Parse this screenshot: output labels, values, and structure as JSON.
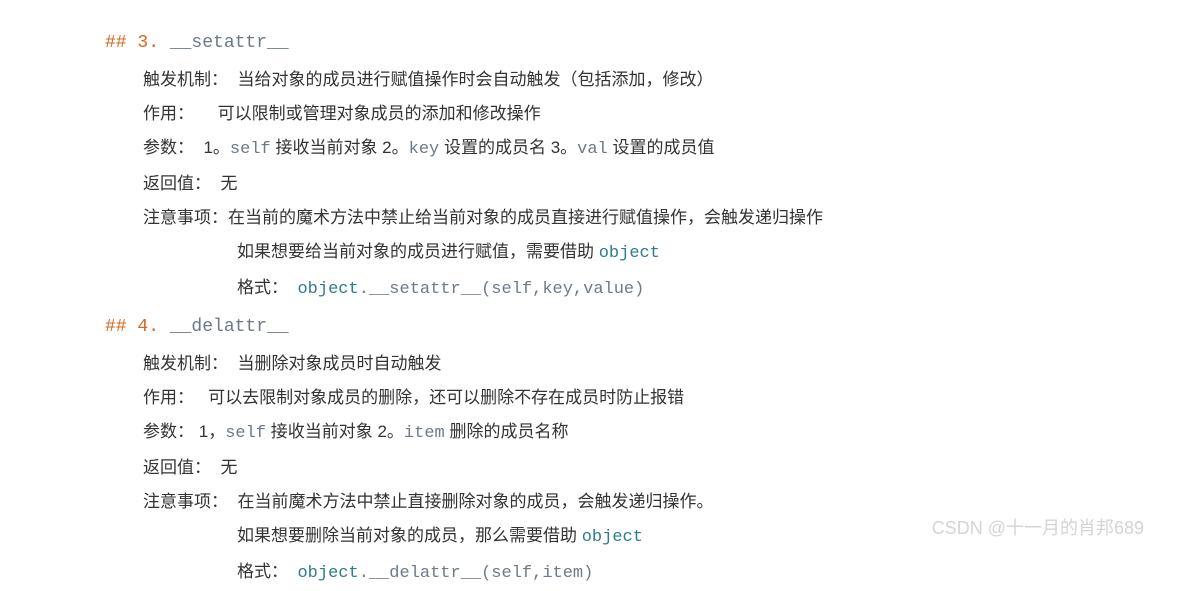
{
  "sections": [
    {
      "heading": {
        "prefix": "## 3. ",
        "method": "__setattr__"
      },
      "lines": {
        "trigger_label": "触发机制：",
        "trigger_text": "当给对象的成员进行赋值操作时会自动触发（包括添加，修改）",
        "use_label": "作用：",
        "use_text": "可以限制或管理对象成员的添加和修改操作",
        "param_label": "参数：",
        "param_text_1": "1。",
        "param_code_1": "self",
        "param_mid_1": " 接收当前对象   2。",
        "param_code_2": "key",
        "param_mid_2": " 设置的成员名   3。",
        "param_code_3": "val",
        "param_mid_3": " 设置的成员值",
        "return_label": "返回值：",
        "return_text": "无",
        "note_label": "注意事项：",
        "note_text_1": "在当前的魔术方法中禁止给当前对象的成员直接进行赋值操作，会触发递归操作",
        "note_text_2_a": "如果想要给当前对象的成员进行赋值，需要借助 ",
        "note_text_2_obj": "object",
        "format_label": "格式： ",
        "format_obj": "object",
        "format_code_a": ".",
        "format_method": "__setattr__",
        "format_code_b": "(self,key,value)"
      }
    },
    {
      "heading": {
        "prefix": "## 4. ",
        "method": "__delattr__"
      },
      "lines": {
        "trigger_label": "触发机制：",
        "trigger_text": "当删除对象成员时自动触发",
        "use_label": "作用：",
        "use_text": "可以去限制对象成员的删除，还可以删除不存在成员时防止报错",
        "param_label": "参数：",
        "param_text_1": "1，",
        "param_code_1": "self",
        "param_mid_1": " 接收当前对象   2。",
        "param_code_2": "item",
        "param_mid_2": " 删除的成员名称",
        "return_label": "返回值：",
        "return_text": "无",
        "note_label": "注意事项：",
        "note_text_1": "在当前魔术方法中禁止直接删除对象的成员，会触发递归操作。",
        "note_text_2_a": "如果想要删除当前对象的成员，那么需要借助 ",
        "note_text_2_obj": "object",
        "format_label": "格式： ",
        "format_obj": "object",
        "format_code_a": ".",
        "format_method": "__delattr__",
        "format_code_b": "(self,item)"
      }
    }
  ],
  "watermark": "CSDN @十一月的肖邦689"
}
